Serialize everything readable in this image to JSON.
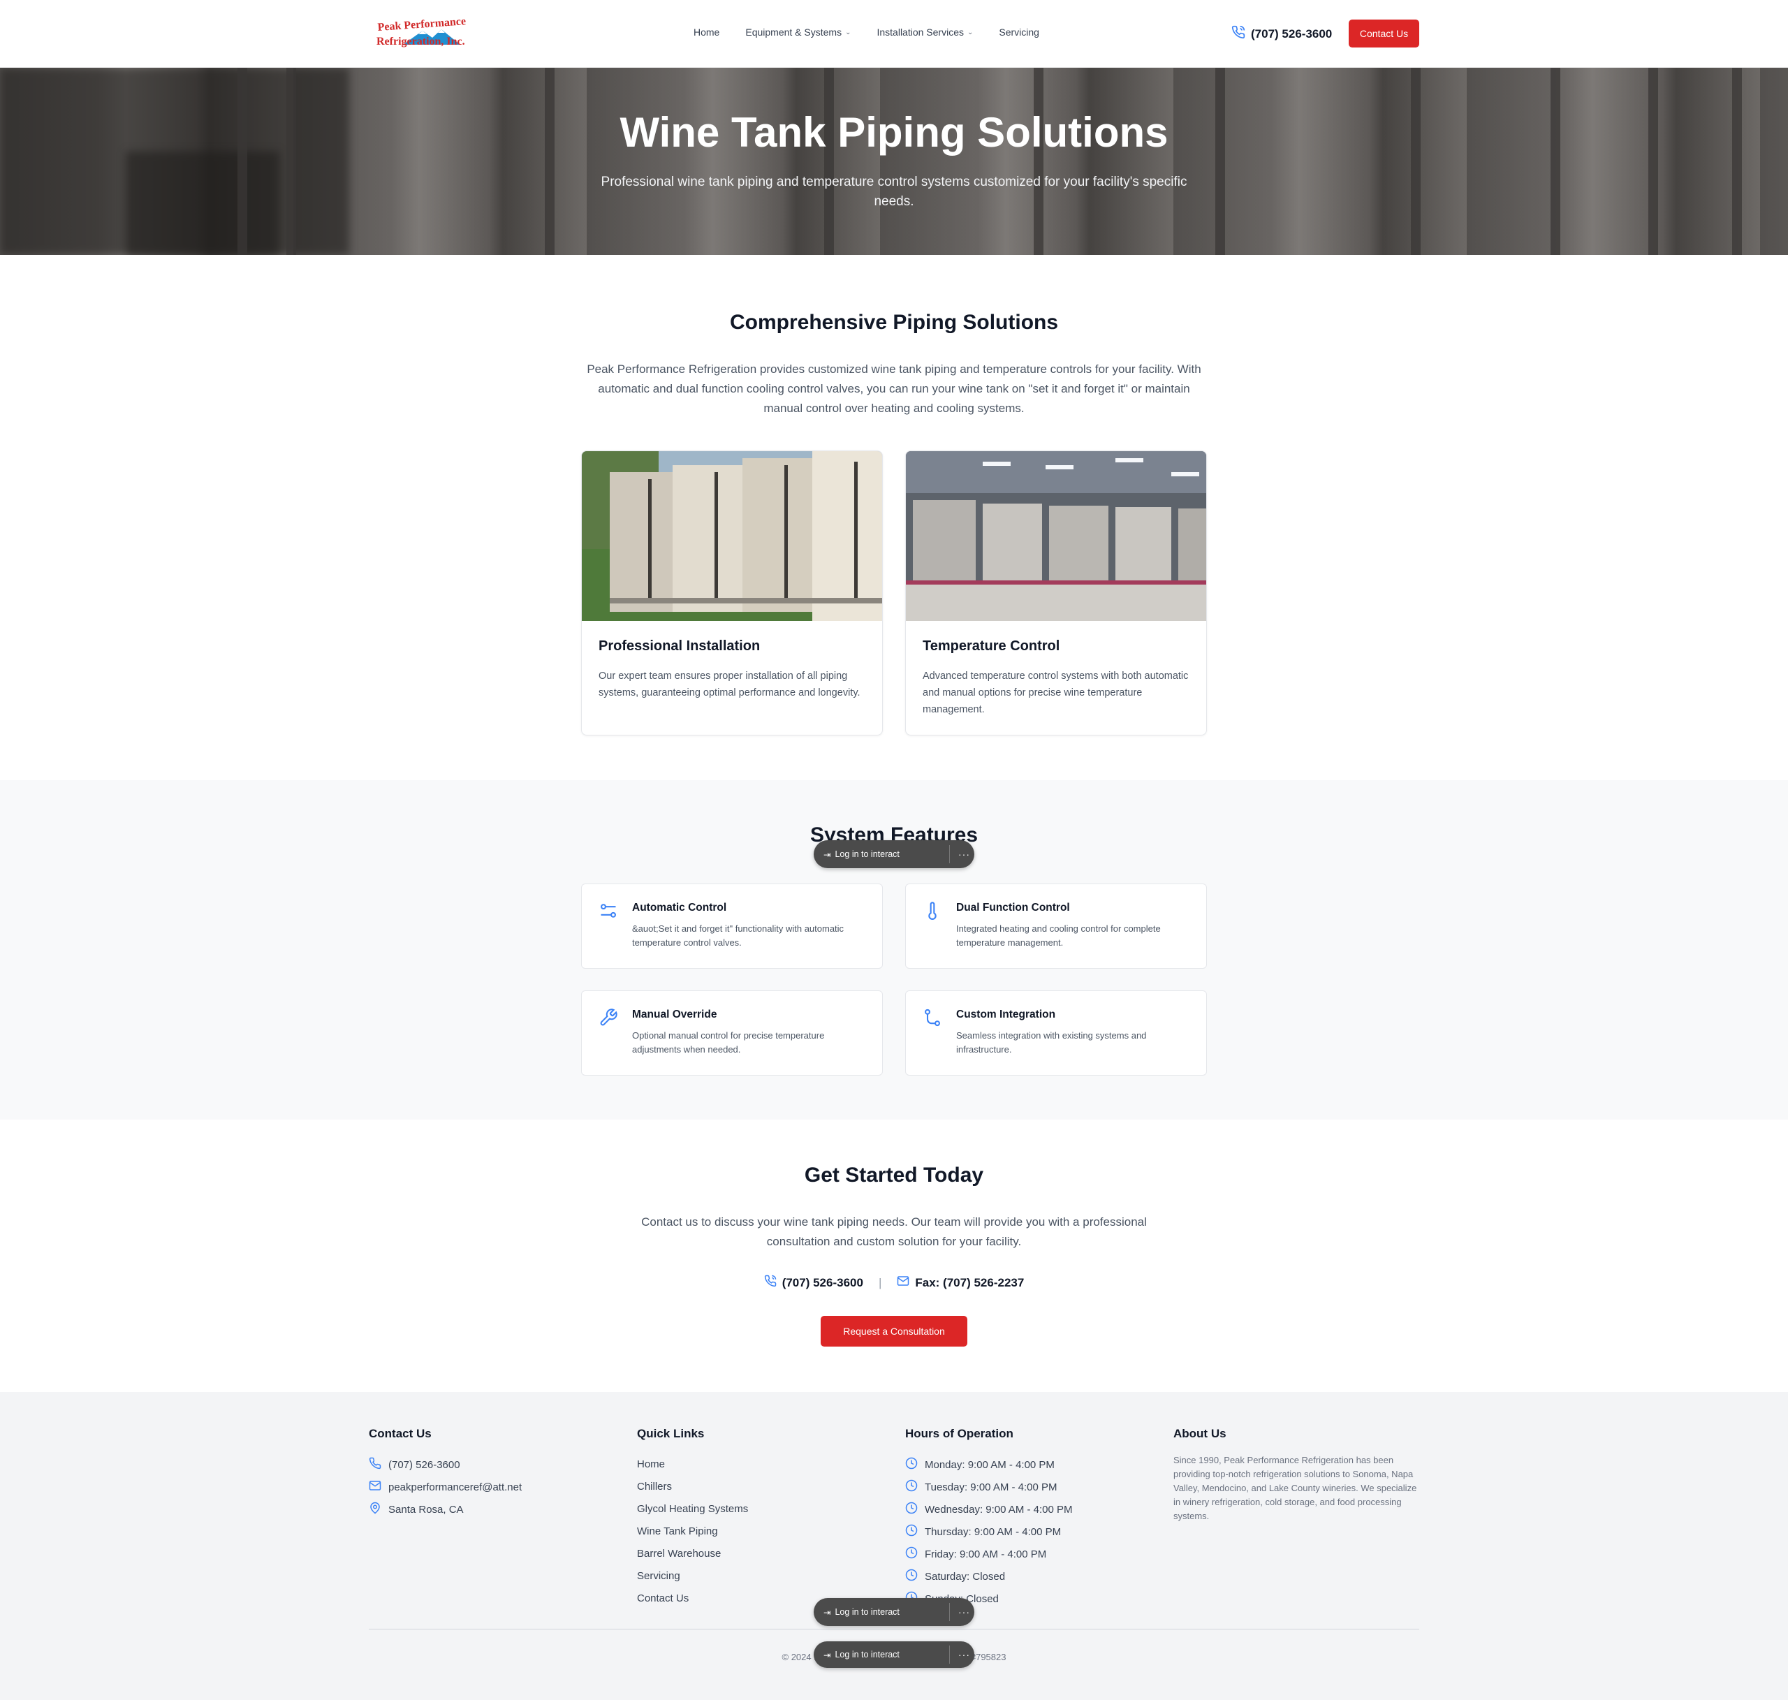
{
  "header": {
    "logo_line1": "Peak Performance",
    "logo_line2": "Refrigeration, Inc.",
    "nav": [
      {
        "label": "Home",
        "has_dropdown": false
      },
      {
        "label": "Equipment & Systems",
        "has_dropdown": true
      },
      {
        "label": "Installation Services",
        "has_dropdown": true
      },
      {
        "label": "Servicing",
        "has_dropdown": false
      }
    ],
    "phone": "(707) 526-3600",
    "contact_button": "Contact Us"
  },
  "hero": {
    "title": "Wine Tank Piping Solutions",
    "subtitle": "Professional wine tank piping and temperature control systems customized for your facility's specific needs."
  },
  "solutions": {
    "heading": "Comprehensive Piping Solutions",
    "intro": "Peak Performance Refrigeration provides customized wine tank piping and temperature controls for your facility. With automatic and dual function cooling control valves, you can run your wine tank on \"set it and forget it\" or maintain manual control over heating and cooling systems.",
    "cards": [
      {
        "title": "Professional Installation",
        "text": "Our expert team ensures proper installation of all piping systems, guaranteeing optimal performance and longevity."
      },
      {
        "title": "Temperature Control",
        "text": "Advanced temperature control systems with both automatic and manual options for precise wine temperature management."
      }
    ]
  },
  "features": {
    "heading": "System Features",
    "items": [
      {
        "title": "Automatic Control",
        "text": "&auot;Set it and forget it\" functionality with automatic temperature control valves.",
        "icon": "sliders-icon"
      },
      {
        "title": "Dual Function Control",
        "text": "Integrated heating and cooling control for complete temperature management.",
        "icon": "thermometer-icon"
      },
      {
        "title": "Manual Override",
        "text": "Optional manual control for precise temperature adjustments when needed.",
        "icon": "wrench-icon"
      },
      {
        "title": "Custom Integration",
        "text": "Seamless integration with existing systems and infrastructure.",
        "icon": "route-icon"
      }
    ]
  },
  "get_started": {
    "heading": "Get Started Today",
    "text": "Contact us to discuss your wine tank piping needs. Our team will provide you with a professional consultation and custom solution for your facility.",
    "phone": "(707) 526-3600",
    "fax": "Fax: (707) 526-2237",
    "button": "Request a Consultation"
  },
  "footer": {
    "contact": {
      "heading": "Contact Us",
      "phone": "(707) 526-3600",
      "email": "peakperformanceref@att.net",
      "location": "Santa Rosa, CA"
    },
    "quick_links": {
      "heading": "Quick Links",
      "links": [
        "Home",
        "Chillers",
        "Glycol Heating Systems",
        "Wine Tank Piping",
        "Barrel Warehouse",
        "Servicing",
        "Contact Us"
      ]
    },
    "hours": {
      "heading": "Hours of Operation",
      "rows": [
        "Monday: 9:00 AM - 4:00 PM",
        "Tuesday: 9:00 AM - 4:00 PM",
        "Wednesday: 9:00 AM - 4:00 PM",
        "Thursday: 9:00 AM - 4:00 PM",
        "Friday: 9:00 AM - 4:00 PM",
        "Saturday: Closed",
        "Sunday: Closed"
      ]
    },
    "about": {
      "heading": "About Us",
      "text": "Since 1990, Peak Performance Refrigeration has been providing top-notch refrigeration solutions to Sonoma, Napa Valley, Mendocino, and Lake County wineries. We specialize in winery refrigeration, cold storage, and food processing systems."
    },
    "copyright_left": "© 2024 Pe",
    "copyright_right": "c. #795823"
  },
  "overlay": {
    "pill_label": "Log in to interact",
    "pill_menu": "···"
  },
  "colors": {
    "brand_red": "#dc2626",
    "icon_blue": "#3b82f6",
    "logo_red": "#d12a2a",
    "logo_blue": "#1f8fd1"
  }
}
